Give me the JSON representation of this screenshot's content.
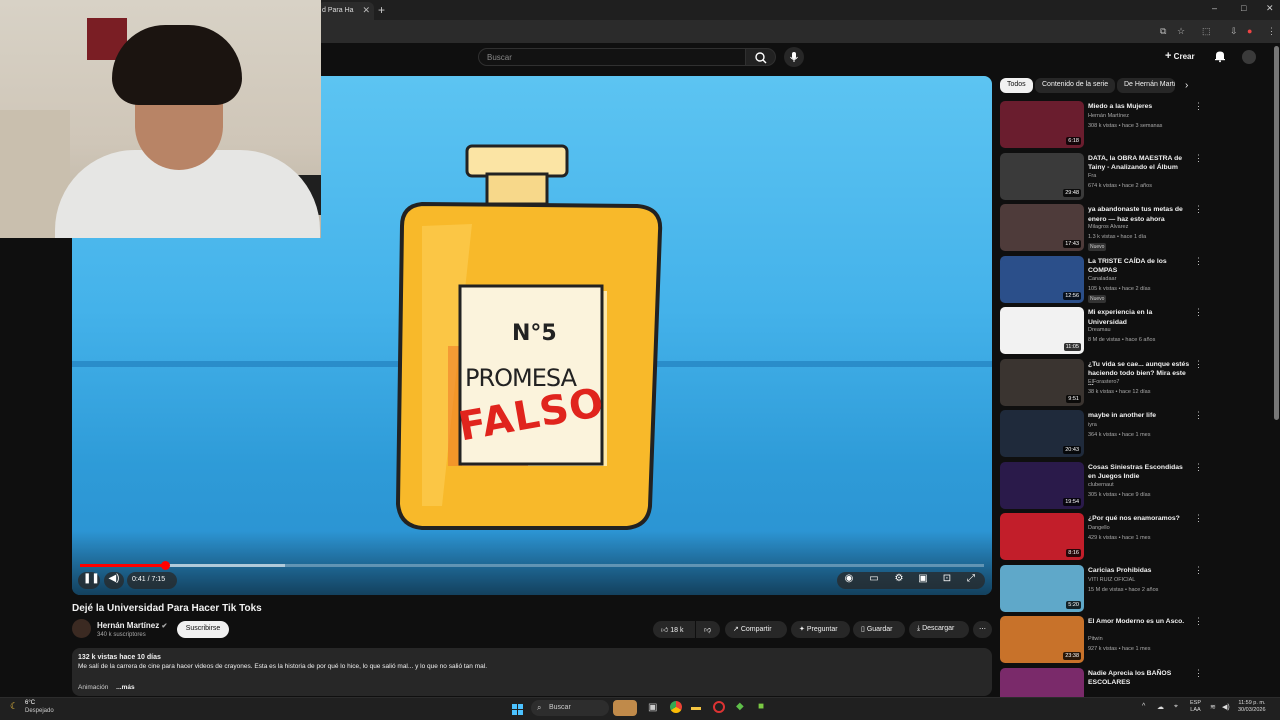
{
  "browser": {
    "tab_title": "d Para Ha",
    "new_tab_label": "+",
    "window_controls": [
      "–",
      "□",
      "✕"
    ]
  },
  "youtube_header": {
    "search_placeholder": "Buscar",
    "create_label": "Crear"
  },
  "player": {
    "time": "0:41 / 7:15",
    "progress_fraction": 0.094,
    "buffered_fraction": 0.227,
    "artwork_label_top": "N°5",
    "artwork_label_mid": "PROMESA",
    "artwork_label_stamp": "FALSO"
  },
  "video": {
    "title": "Dejé la Universidad Para Hacer Tik Toks",
    "channel": "Hernán Martínez",
    "subscribers": "340 k suscriptores",
    "subscribe_label": "Suscribirse",
    "likes": "18 k",
    "share_label": "Compartir",
    "ask_label": "Preguntar",
    "save_label": "Guardar",
    "download_label": "Descargar",
    "stats": "132 k vistas  hace 10 días",
    "description": "Me salí de la carrera de cine para hacer videos de crayones. Esta es la historia de por qué lo hice, lo que salió mal... y lo que no salió tan mal.",
    "category": "Animación",
    "more_label": "...más"
  },
  "chips": [
    "Todos",
    "Contenido de la serie",
    "De Hernán Martínez"
  ],
  "recommendations": [
    {
      "title": "Miedo a las Mujeres",
      "channel": "Hernán Martínez",
      "meta": "308 k vistas • hace 3 semanas",
      "duration": "6:18",
      "color": "#6a1d2e",
      "badge": ""
    },
    {
      "title": "DATA, la OBRA MAESTRA de Tainy - Analizando el Álbum",
      "channel": "Fra",
      "meta": "674 k vistas • hace 2 años",
      "duration": "29:48",
      "color": "#3a3a3a",
      "badge": ""
    },
    {
      "title": "ya abandonaste tus metas de enero — haz esto ahora",
      "channel": "Milagros Alvarez",
      "meta": "1.3 k vistas • hace 1 día",
      "duration": "17:43",
      "color": "#4e3b3a",
      "badge": "Nuevo"
    },
    {
      "title": "La TRISTE CAÍDA de los COMPAS",
      "channel": "Canaladaar",
      "meta": "105 k vistas • hace 2 días",
      "duration": "12:56",
      "color": "#2b4f8a",
      "badge": "Nuevo"
    },
    {
      "title": "Mi experiencia en la Universidad",
      "channel": "Dreamau",
      "meta": "8 M de vistas • hace 6 años",
      "duration": "11:05",
      "color": "#f2f2f2",
      "badge": ""
    },
    {
      "title": "¿Tu vida se cae... aunque estés haciendo todo bien? Mira este ...",
      "channel": "ElForastero7",
      "meta": "38 k vistas • hace 12 días",
      "duration": "9:51",
      "color": "#3a3430",
      "badge": ""
    },
    {
      "title": "maybe in another life",
      "channel": "iyra",
      "meta": "364 k vistas • hace 1 mes",
      "duration": "20:43",
      "color": "#1f2a3b",
      "badge": ""
    },
    {
      "title": "Cosas Siniestras Escondidas en Juegos Indie",
      "channel": "clubernaut",
      "meta": "305 k vistas • hace 9 días",
      "duration": "19:54",
      "color": "#2a1a4a",
      "badge": ""
    },
    {
      "title": "¿Por qué nos enamoramos?",
      "channel": "Dangello",
      "meta": "429 k vistas • hace 1 mes",
      "duration": "8:16",
      "color": "#c21e2a",
      "badge": ""
    },
    {
      "title": "Caricias Prohibidas",
      "channel": "VITI RUIZ OFICIAL",
      "meta": "15 M de vistas • hace 2 años",
      "duration": "5:20",
      "color": "#5fa8c9",
      "badge": ""
    },
    {
      "title": "El Amor Moderno es un Asco.",
      "channel": "Pitwin",
      "meta": "927 k vistas • hace 1 mes",
      "duration": "23:38",
      "color": "#c8722a",
      "badge": ""
    },
    {
      "title": "Nadie Aprecia los BAÑOS ESCOLARES",
      "channel": "",
      "meta": "",
      "duration": "",
      "color": "#7a2a6a",
      "badge": ""
    }
  ],
  "taskbar": {
    "weather_temp": "6°C",
    "weather_desc": "Despejado",
    "search_label": "Buscar",
    "lang_top": "ESP",
    "lang_bottom": "LAA",
    "time": "11:59 p. m.",
    "date": "30/03/2026"
  }
}
